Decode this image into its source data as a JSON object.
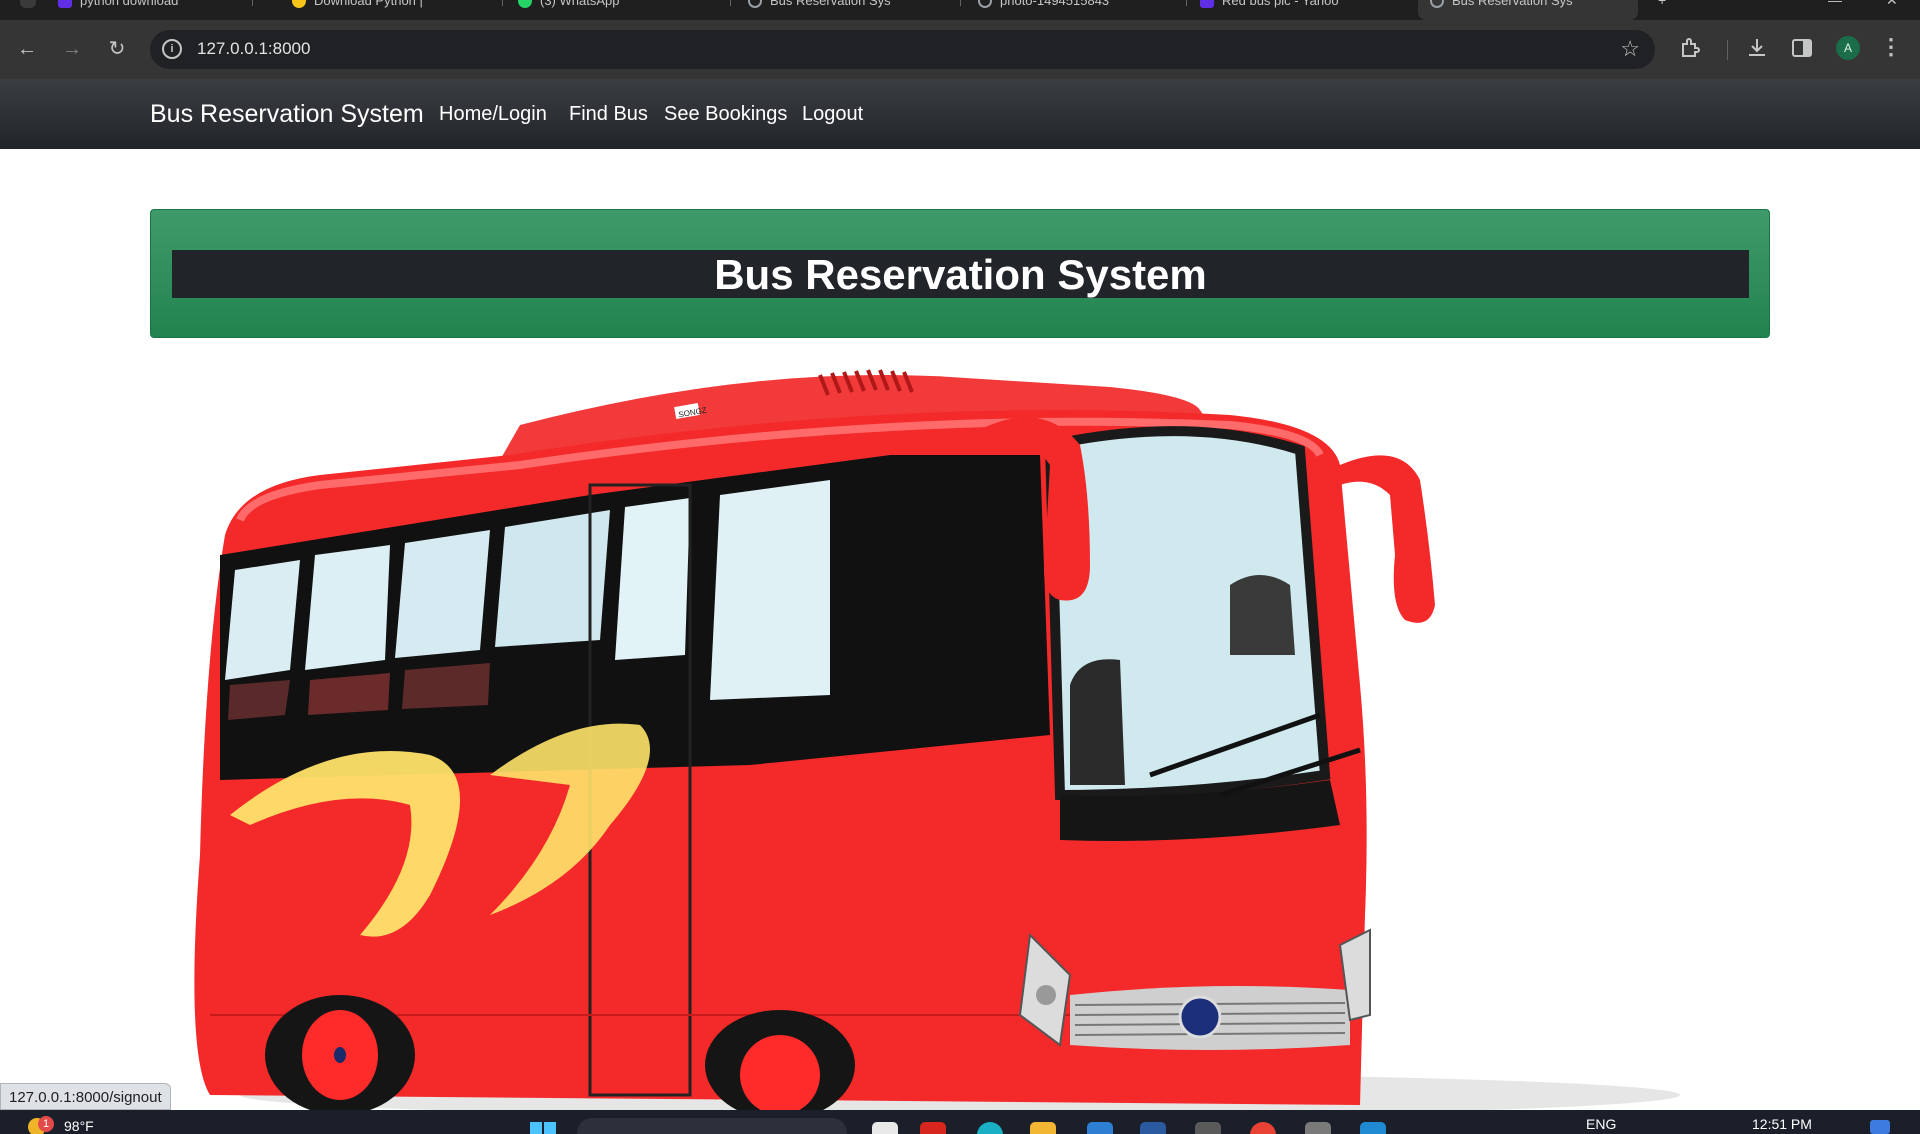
{
  "browser": {
    "tabs": [
      {
        "label": "python download",
        "favicon_color": "#5f2ee5"
      },
      {
        "label": "Download Python |",
        "favicon_color": "#f5c518"
      },
      {
        "label": "(3) WhatsApp",
        "favicon_color": "#25d366"
      },
      {
        "label": "Bus Reservation Sys",
        "favicon_color": "#9aa0a6"
      },
      {
        "label": "photo-1494515843",
        "favicon_color": "#9aa0a6"
      },
      {
        "label": "Red bus pic - Yahoo",
        "favicon_color": "#5f2ee5"
      },
      {
        "label": "Bus Reservation Sys",
        "favicon_color": "#9aa0a6",
        "active": true
      }
    ],
    "url": "127.0.0.1:8000",
    "info_icon": "i",
    "profile_initial": "A",
    "icons": [
      "back-icon",
      "forward-icon",
      "reload-icon",
      "site-info-icon",
      "bookmark-star-icon",
      "extensions-icon",
      "download-icon",
      "side-panel-icon",
      "profile-avatar",
      "menu-kebab-icon"
    ]
  },
  "page": {
    "navbar": {
      "brand": "Bus Reservation System",
      "links": [
        "Home/Login",
        "Find Bus",
        "See Bookings",
        "Logout"
      ]
    },
    "banner_title": "Bus Reservation System",
    "bus_decal": "SONGZ",
    "colors": {
      "navbar": "#212529",
      "banner_green": "#2e8b57",
      "bus_red": "#f32424",
      "swoosh_yellow": "#ffe36a"
    }
  },
  "status_bar": {
    "link_preview": "127.0.0.1:8000/signout"
  },
  "taskbar": {
    "notification_count": "1",
    "weather": "98°F",
    "language": "ENG",
    "time": "12:51 PM"
  }
}
